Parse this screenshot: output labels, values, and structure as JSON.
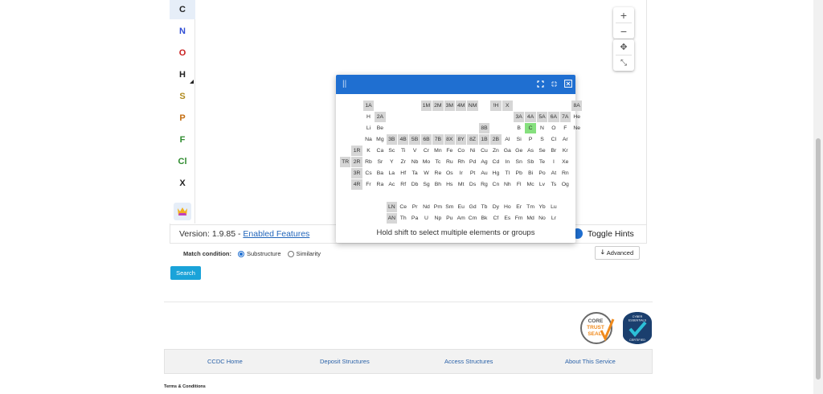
{
  "atoms": [
    {
      "symbol": "C",
      "color": "#222222"
    },
    {
      "symbol": "N",
      "color": "#2f4cd4"
    },
    {
      "symbol": "O",
      "color": "#c81e1e"
    },
    {
      "symbol": "H",
      "color": "#222222"
    },
    {
      "symbol": "S",
      "color": "#b08a1e"
    },
    {
      "symbol": "P",
      "color": "#c46d10"
    },
    {
      "symbol": "F",
      "color": "#2e8b2e"
    },
    {
      "symbol": "Cl",
      "color": "#2e8b2e"
    },
    {
      "symbol": "X",
      "color": "#222222"
    }
  ],
  "zoom": {
    "in": "+",
    "out": "−",
    "move": "✥",
    "fit": "⤡"
  },
  "status": {
    "version_prefix": "Version: 1.9.85 - ",
    "enabled_features": "Enabled Features",
    "toggle_hints": "Toggle Hints"
  },
  "periodic_table": {
    "hint": "Hold shift to select multiple elements or groups",
    "selected": "C",
    "cells": [
      {
        "c": 2,
        "r": 0,
        "t": "1A",
        "g": true
      },
      {
        "c": 7,
        "r": 0,
        "t": "1M",
        "g": true
      },
      {
        "c": 8,
        "r": 0,
        "t": "2M",
        "g": true
      },
      {
        "c": 9,
        "r": 0,
        "t": "3M",
        "g": true
      },
      {
        "c": 10,
        "r": 0,
        "t": "4M",
        "g": true
      },
      {
        "c": 11,
        "r": 0,
        "t": "NM",
        "g": true
      },
      {
        "c": 13,
        "r": 0,
        "t": "!H",
        "g": true
      },
      {
        "c": 14,
        "r": 0,
        "t": "X",
        "g": true
      },
      {
        "c": 20,
        "r": 0,
        "t": "8A",
        "g": true
      },
      {
        "c": 2,
        "r": 1,
        "t": "H"
      },
      {
        "c": 3,
        "r": 1,
        "t": "2A",
        "g": true
      },
      {
        "c": 15,
        "r": 1,
        "t": "3A",
        "g": true
      },
      {
        "c": 16,
        "r": 1,
        "t": "4A",
        "g": true
      },
      {
        "c": 17,
        "r": 1,
        "t": "5A",
        "g": true
      },
      {
        "c": 18,
        "r": 1,
        "t": "6A",
        "g": true
      },
      {
        "c": 19,
        "r": 1,
        "t": "7A",
        "g": true
      },
      {
        "c": 20,
        "r": 1,
        "t": "He"
      },
      {
        "c": 2,
        "r": 2,
        "t": "Li"
      },
      {
        "c": 3,
        "r": 2,
        "t": "Be"
      },
      {
        "c": 12,
        "r": 2,
        "t": "8B",
        "g": true
      },
      {
        "c": 15,
        "r": 2,
        "t": "B"
      },
      {
        "c": 16,
        "r": 2,
        "t": "C"
      },
      {
        "c": 17,
        "r": 2,
        "t": "N"
      },
      {
        "c": 18,
        "r": 2,
        "t": "O"
      },
      {
        "c": 19,
        "r": 2,
        "t": "F"
      },
      {
        "c": 20,
        "r": 2,
        "t": "Ne"
      },
      {
        "c": 2,
        "r": 3,
        "t": "Na"
      },
      {
        "c": 3,
        "r": 3,
        "t": "Mg"
      },
      {
        "c": 4,
        "r": 3,
        "t": "3B",
        "g": true
      },
      {
        "c": 5,
        "r": 3,
        "t": "4B",
        "g": true
      },
      {
        "c": 6,
        "r": 3,
        "t": "5B",
        "g": true
      },
      {
        "c": 7,
        "r": 3,
        "t": "6B",
        "g": true
      },
      {
        "c": 8,
        "r": 3,
        "t": "7B",
        "g": true
      },
      {
        "c": 9,
        "r": 3,
        "t": "8X",
        "g": true
      },
      {
        "c": 10,
        "r": 3,
        "t": "8Y",
        "g": true
      },
      {
        "c": 11,
        "r": 3,
        "t": "8Z",
        "g": true
      },
      {
        "c": 12,
        "r": 3,
        "t": "1B",
        "g": true
      },
      {
        "c": 13,
        "r": 3,
        "t": "2B",
        "g": true
      },
      {
        "c": 14,
        "r": 3,
        "t": "Al"
      },
      {
        "c": 15,
        "r": 3,
        "t": "Si"
      },
      {
        "c": 16,
        "r": 3,
        "t": "P"
      },
      {
        "c": 17,
        "r": 3,
        "t": "S"
      },
      {
        "c": 18,
        "r": 3,
        "t": "Cl"
      },
      {
        "c": 19,
        "r": 3,
        "t": "Ar"
      },
      {
        "c": 1,
        "r": 4,
        "t": "1R",
        "g": true
      },
      {
        "c": 2,
        "r": 4,
        "t": "K"
      },
      {
        "c": 3,
        "r": 4,
        "t": "Ca"
      },
      {
        "c": 4,
        "r": 4,
        "t": "Sc"
      },
      {
        "c": 5,
        "r": 4,
        "t": "Ti"
      },
      {
        "c": 6,
        "r": 4,
        "t": "V"
      },
      {
        "c": 7,
        "r": 4,
        "t": "Cr"
      },
      {
        "c": 8,
        "r": 4,
        "t": "Mn"
      },
      {
        "c": 9,
        "r": 4,
        "t": "Fe"
      },
      {
        "c": 10,
        "r": 4,
        "t": "Co"
      },
      {
        "c": 11,
        "r": 4,
        "t": "Ni"
      },
      {
        "c": 12,
        "r": 4,
        "t": "Cu"
      },
      {
        "c": 13,
        "r": 4,
        "t": "Zn"
      },
      {
        "c": 14,
        "r": 4,
        "t": "Ga"
      },
      {
        "c": 15,
        "r": 4,
        "t": "Ge"
      },
      {
        "c": 16,
        "r": 4,
        "t": "As"
      },
      {
        "c": 17,
        "r": 4,
        "t": "Se"
      },
      {
        "c": 18,
        "r": 4,
        "t": "Br"
      },
      {
        "c": 19,
        "r": 4,
        "t": "Kr"
      },
      {
        "c": 0,
        "r": 5,
        "t": "TR",
        "g": true
      },
      {
        "c": 1,
        "r": 5,
        "t": "2R",
        "g": true
      },
      {
        "c": 2,
        "r": 5,
        "t": "Rb"
      },
      {
        "c": 3,
        "r": 5,
        "t": "Sr"
      },
      {
        "c": 4,
        "r": 5,
        "t": "Y"
      },
      {
        "c": 5,
        "r": 5,
        "t": "Zr"
      },
      {
        "c": 6,
        "r": 5,
        "t": "Nb"
      },
      {
        "c": 7,
        "r": 5,
        "t": "Mo"
      },
      {
        "c": 8,
        "r": 5,
        "t": "Tc"
      },
      {
        "c": 9,
        "r": 5,
        "t": "Ru"
      },
      {
        "c": 10,
        "r": 5,
        "t": "Rh"
      },
      {
        "c": 11,
        "r": 5,
        "t": "Pd"
      },
      {
        "c": 12,
        "r": 5,
        "t": "Ag"
      },
      {
        "c": 13,
        "r": 5,
        "t": "Cd"
      },
      {
        "c": 14,
        "r": 5,
        "t": "In"
      },
      {
        "c": 15,
        "r": 5,
        "t": "Sn"
      },
      {
        "c": 16,
        "r": 5,
        "t": "Sb"
      },
      {
        "c": 17,
        "r": 5,
        "t": "Te"
      },
      {
        "c": 18,
        "r": 5,
        "t": "I"
      },
      {
        "c": 19,
        "r": 5,
        "t": "Xe"
      },
      {
        "c": 1,
        "r": 6,
        "t": "3R",
        "g": true
      },
      {
        "c": 2,
        "r": 6,
        "t": "Cs"
      },
      {
        "c": 3,
        "r": 6,
        "t": "Ba"
      },
      {
        "c": 4,
        "r": 6,
        "t": "La"
      },
      {
        "c": 5,
        "r": 6,
        "t": "Hf"
      },
      {
        "c": 6,
        "r": 6,
        "t": "Ta"
      },
      {
        "c": 7,
        "r": 6,
        "t": "W"
      },
      {
        "c": 8,
        "r": 6,
        "t": "Re"
      },
      {
        "c": 9,
        "r": 6,
        "t": "Os"
      },
      {
        "c": 10,
        "r": 6,
        "t": "Ir"
      },
      {
        "c": 11,
        "r": 6,
        "t": "Pt"
      },
      {
        "c": 12,
        "r": 6,
        "t": "Au"
      },
      {
        "c": 13,
        "r": 6,
        "t": "Hg"
      },
      {
        "c": 14,
        "r": 6,
        "t": "Tl"
      },
      {
        "c": 15,
        "r": 6,
        "t": "Pb"
      },
      {
        "c": 16,
        "r": 6,
        "t": "Bi"
      },
      {
        "c": 17,
        "r": 6,
        "t": "Po"
      },
      {
        "c": 18,
        "r": 6,
        "t": "At"
      },
      {
        "c": 19,
        "r": 6,
        "t": "Rn"
      },
      {
        "c": 1,
        "r": 7,
        "t": "4R",
        "g": true
      },
      {
        "c": 2,
        "r": 7,
        "t": "Fr"
      },
      {
        "c": 3,
        "r": 7,
        "t": "Ra"
      },
      {
        "c": 4,
        "r": 7,
        "t": "Ac"
      },
      {
        "c": 5,
        "r": 7,
        "t": "Rf"
      },
      {
        "c": 6,
        "r": 7,
        "t": "Db"
      },
      {
        "c": 7,
        "r": 7,
        "t": "Sg"
      },
      {
        "c": 8,
        "r": 7,
        "t": "Bh"
      },
      {
        "c": 9,
        "r": 7,
        "t": "Hs"
      },
      {
        "c": 10,
        "r": 7,
        "t": "Mt"
      },
      {
        "c": 11,
        "r": 7,
        "t": "Ds"
      },
      {
        "c": 12,
        "r": 7,
        "t": "Rg"
      },
      {
        "c": 13,
        "r": 7,
        "t": "Cn"
      },
      {
        "c": 14,
        "r": 7,
        "t": "Nh"
      },
      {
        "c": 15,
        "r": 7,
        "t": "Fl"
      },
      {
        "c": 16,
        "r": 7,
        "t": "Mc"
      },
      {
        "c": 17,
        "r": 7,
        "t": "Lv"
      },
      {
        "c": 18,
        "r": 7,
        "t": "Ts"
      },
      {
        "c": 19,
        "r": 7,
        "t": "Og"
      },
      {
        "c": 4,
        "r": 9,
        "t": "LN",
        "g": true
      },
      {
        "c": 5,
        "r": 9,
        "t": "Ce"
      },
      {
        "c": 6,
        "r": 9,
        "t": "Pr"
      },
      {
        "c": 7,
        "r": 9,
        "t": "Nd"
      },
      {
        "c": 8,
        "r": 9,
        "t": "Pm"
      },
      {
        "c": 9,
        "r": 9,
        "t": "Sm"
      },
      {
        "c": 10,
        "r": 9,
        "t": "Eu"
      },
      {
        "c": 11,
        "r": 9,
        "t": "Gd"
      },
      {
        "c": 12,
        "r": 9,
        "t": "Tb"
      },
      {
        "c": 13,
        "r": 9,
        "t": "Dy"
      },
      {
        "c": 14,
        "r": 9,
        "t": "Ho"
      },
      {
        "c": 15,
        "r": 9,
        "t": "Er"
      },
      {
        "c": 16,
        "r": 9,
        "t": "Tm"
      },
      {
        "c": 17,
        "r": 9,
        "t": "Yb"
      },
      {
        "c": 18,
        "r": 9,
        "t": "Lu"
      },
      {
        "c": 4,
        "r": 10,
        "t": "AN",
        "g": true
      },
      {
        "c": 5,
        "r": 10,
        "t": "Th"
      },
      {
        "c": 6,
        "r": 10,
        "t": "Pa"
      },
      {
        "c": 7,
        "r": 10,
        "t": "U"
      },
      {
        "c": 8,
        "r": 10,
        "t": "Np"
      },
      {
        "c": 9,
        "r": 10,
        "t": "Pu"
      },
      {
        "c": 10,
        "r": 10,
        "t": "Am"
      },
      {
        "c": 11,
        "r": 10,
        "t": "Cm"
      },
      {
        "c": 12,
        "r": 10,
        "t": "Bk"
      },
      {
        "c": 13,
        "r": 10,
        "t": "Cf"
      },
      {
        "c": 14,
        "r": 10,
        "t": "Es"
      },
      {
        "c": 15,
        "r": 10,
        "t": "Fm"
      },
      {
        "c": 16,
        "r": 10,
        "t": "Md"
      },
      {
        "c": 17,
        "r": 10,
        "t": "No"
      },
      {
        "c": 18,
        "r": 10,
        "t": "Lr"
      }
    ]
  },
  "form": {
    "match_label": "Match condition:",
    "substructure": "Substructure",
    "similarity": "Similarity",
    "selected_condition": "Substructure",
    "advanced": "Advanced",
    "search": "Search"
  },
  "badges": {
    "core_top": "CORE",
    "core_mid": "TRUST",
    "core_bot": "SEAL",
    "cyber_top": "CYBER",
    "cyber_mid": "ESSENTIALS",
    "cyber_bot": "CERTIFIED"
  },
  "footer": {
    "links": [
      "CCDC Home",
      "Deposit Structures",
      "Access Structures",
      "About This Service"
    ],
    "terms": "Terms & Conditions"
  },
  "colors": {
    "accent": "#1f6fd1",
    "search_button": "#1aa3d9",
    "selected_element": "#86e07e",
    "link": "#2b62a8"
  }
}
